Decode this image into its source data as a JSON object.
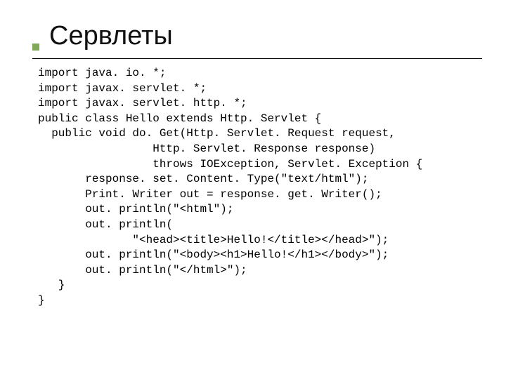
{
  "slide": {
    "title": "Сервлеты",
    "code": "import java. io. *;\nimport javax. servlet. *;\nimport javax. servlet. http. *;\npublic class Hello extends Http. Servlet {\n  public void do. Get(Http. Servlet. Request request,\n                 Http. Servlet. Response response)\n                 throws IOException, Servlet. Exception {\n       response. set. Content. Type(\"text/html\");\n       Print. Writer out = response. get. Writer();\n       out. println(\"<html\");\n       out. println(\n              \"<head><title>Hello!</title></head>\");\n       out. println(\"<body><h1>Hello!</h1></body>\");\n       out. println(\"</html>\");\n   }\n}"
  }
}
